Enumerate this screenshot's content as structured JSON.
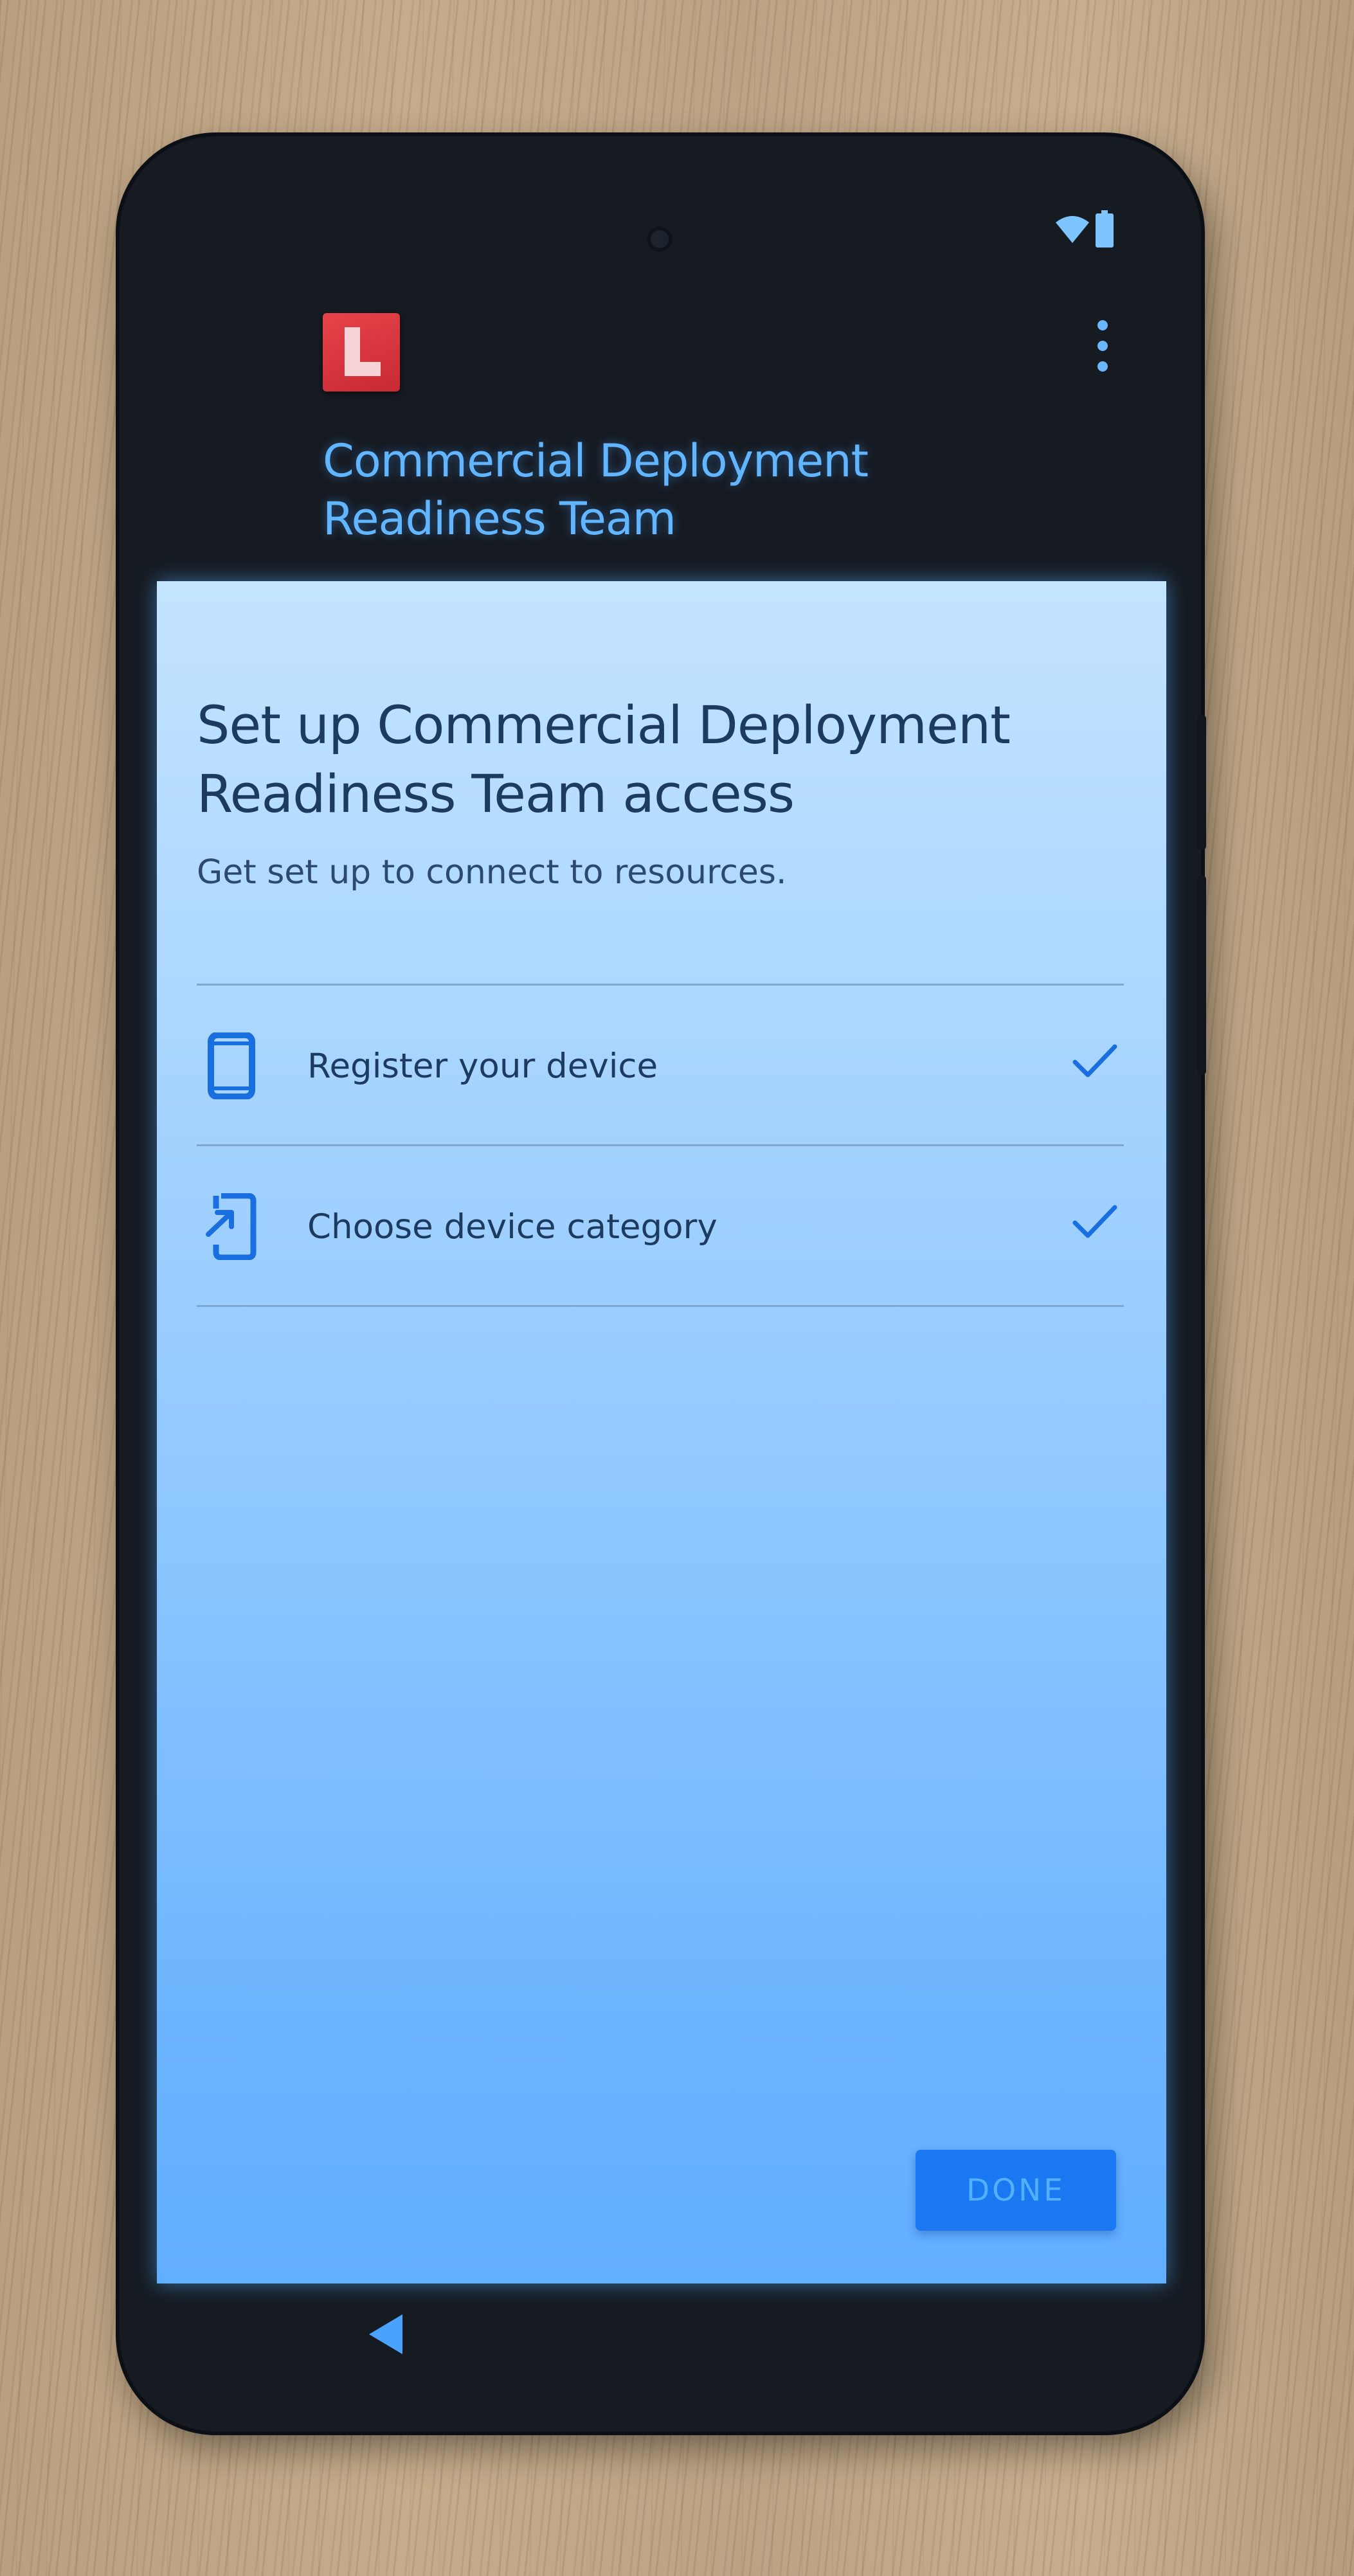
{
  "app": {
    "organization_name": "Commercial Deployment Readiness Team",
    "logo_icon": "company-portal-logo-icon",
    "overflow_icon": "more-vert-icon"
  },
  "status_bar": {
    "icons": [
      "wifi-icon",
      "battery-icon"
    ]
  },
  "setup": {
    "title": "Set up Commercial Deployment Readiness Team access",
    "subtitle": "Get set up to connect to resources.",
    "steps": [
      {
        "label": "Register your device",
        "icon": "phone-icon",
        "status": "complete",
        "status_icon": "checkmark-icon"
      },
      {
        "label": "Choose device category",
        "icon": "phone-enter-icon",
        "status": "complete",
        "status_icon": "checkmark-icon"
      }
    ],
    "done_label": "DONE"
  },
  "navigation_bar": {
    "back_icon": "back-triangle-icon"
  },
  "colors": {
    "screen_background": "#b0d9ff",
    "accent": "#1a78f0",
    "header_text": "#62b6ff",
    "body_text": "#1d3a5f",
    "logo_red": "#d9343c"
  }
}
